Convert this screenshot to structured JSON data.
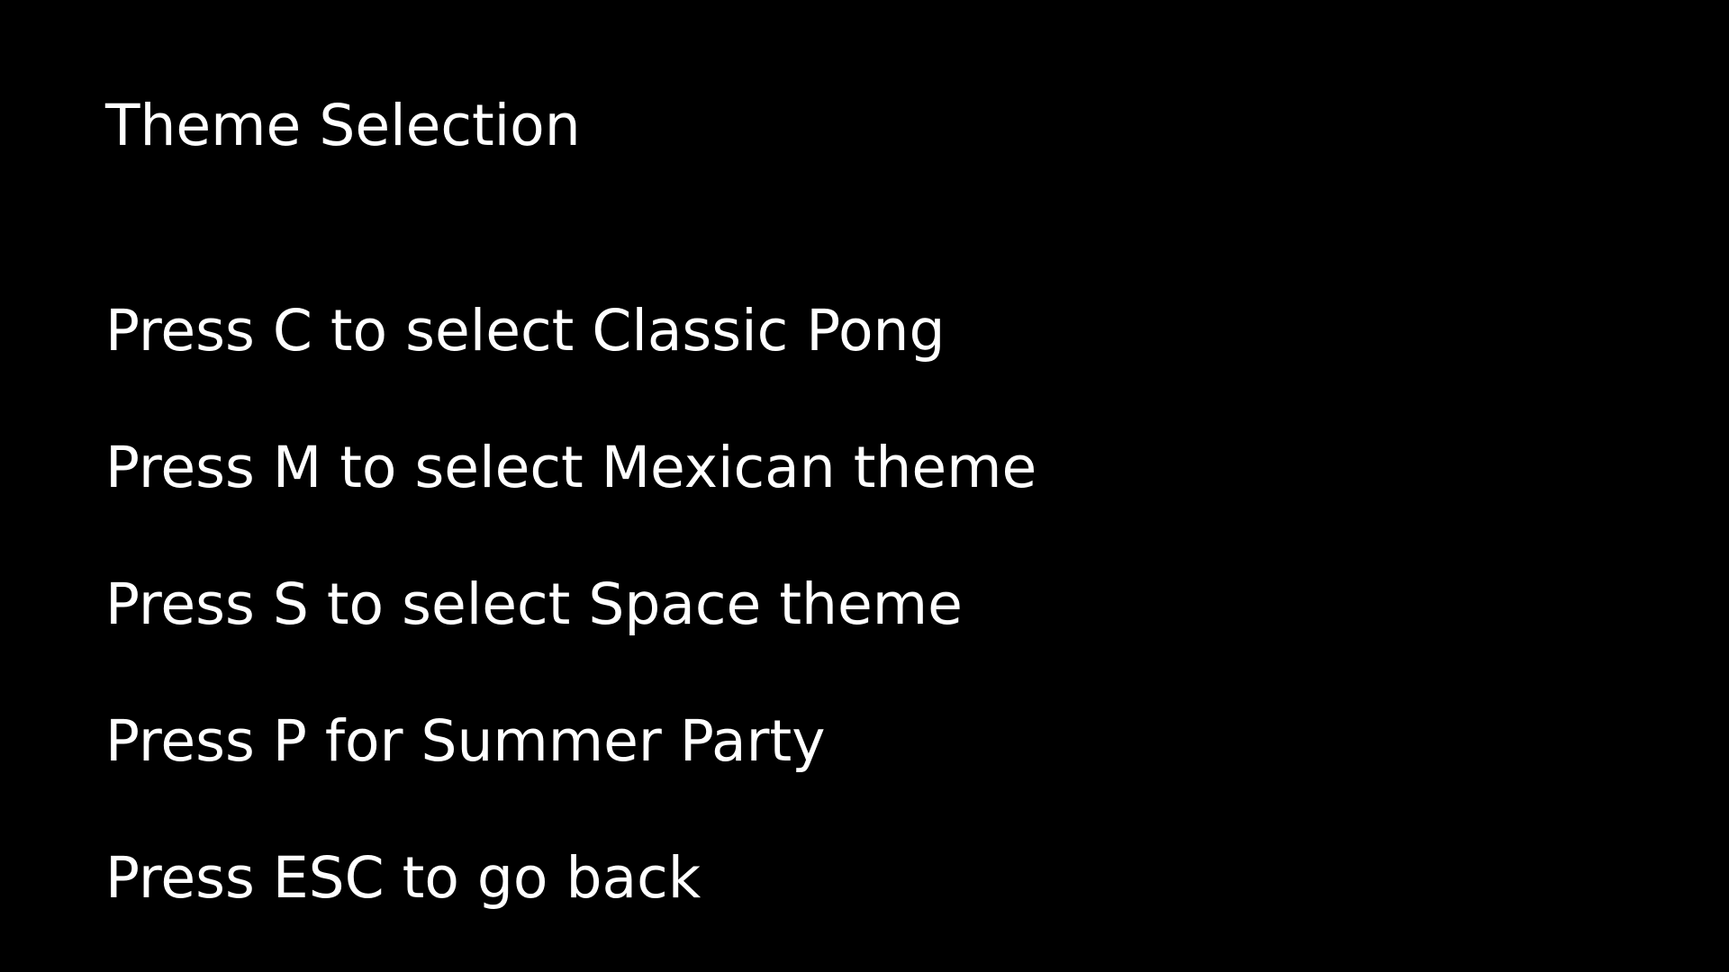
{
  "screen": {
    "title": "Theme Selection",
    "options": [
      {
        "label": "Press C to select Classic Pong",
        "key": "C"
      },
      {
        "label": "Press M to select Mexican theme",
        "key": "M"
      },
      {
        "label": "Press S to select Space theme",
        "key": "S"
      },
      {
        "label": "Press P for Summer Party",
        "key": "P"
      },
      {
        "label": "Press ESC to go back",
        "key": "ESC"
      }
    ]
  },
  "colors": {
    "background": "#000000",
    "text": "#ffffff"
  }
}
